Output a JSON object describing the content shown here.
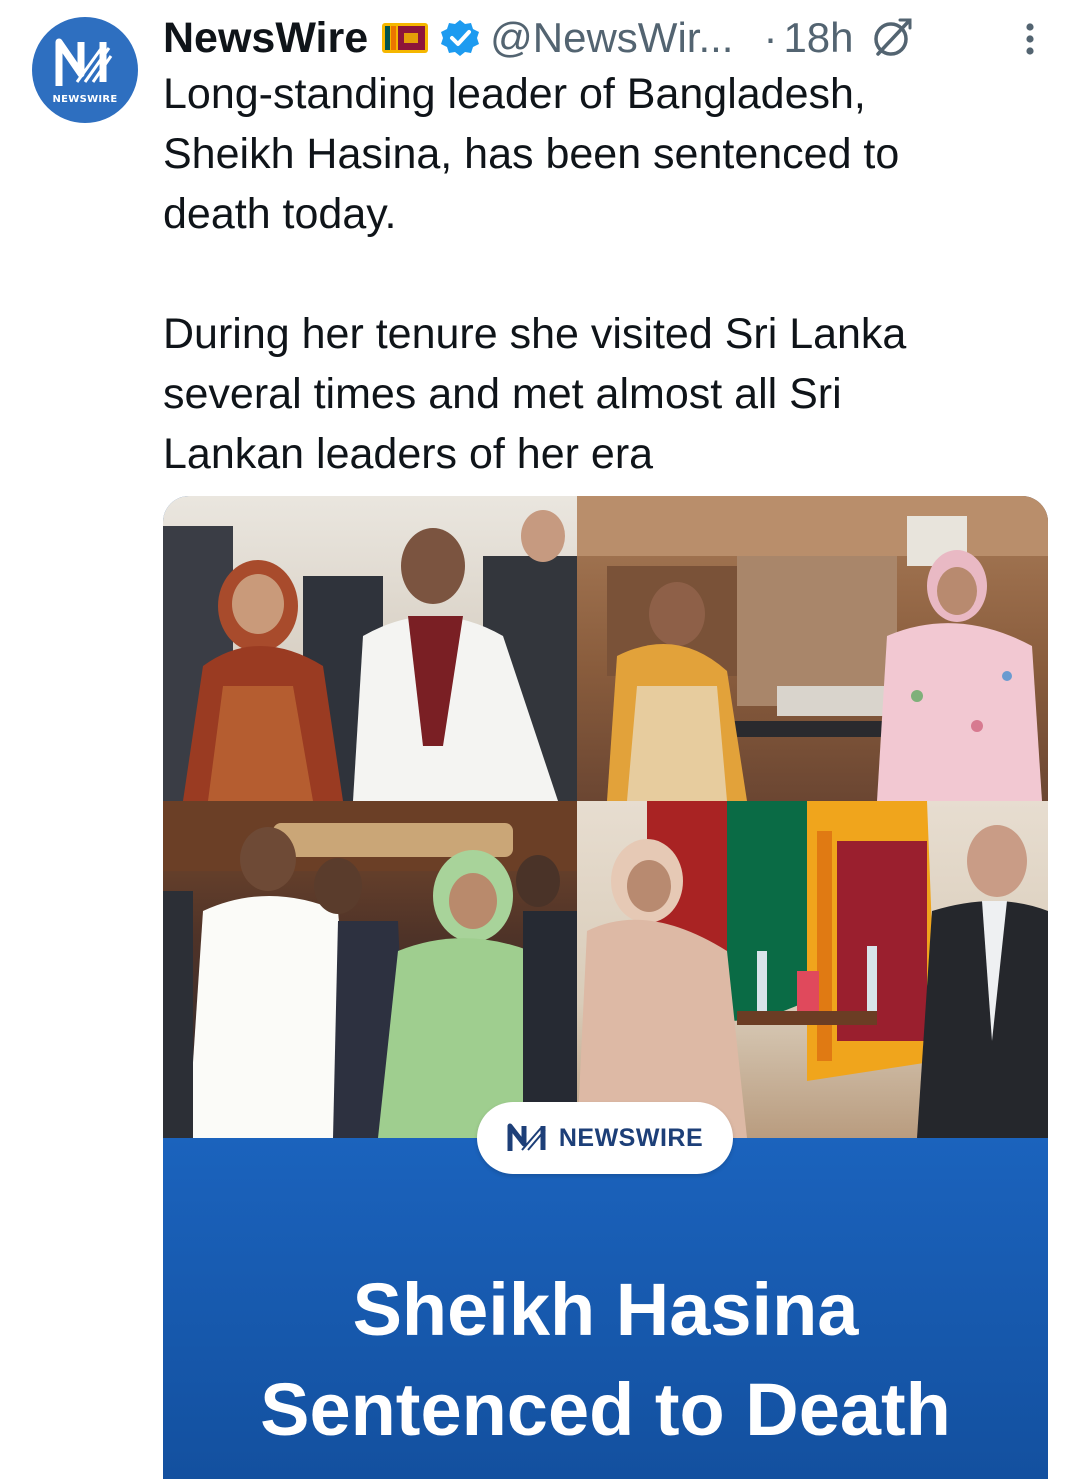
{
  "account": {
    "display_name": "NewsWire",
    "handle": "@NewsWir...",
    "separator": "·",
    "time": "18h",
    "avatar_label": "NEWSWIRE",
    "flag_icon": "sri-lanka-flag-emoji",
    "verified_icon": "verified-badge-icon",
    "verified_color": "#1d9bf0"
  },
  "tweet": {
    "paragraph_1": "Long-standing leader of Bangladesh,\nSheikh Hasina, has been sentenced to\ndeath today.",
    "paragraph_2": "During her tenure she visited Sri Lanka\nseveral times and met almost all Sri\nLankan leaders of her era"
  },
  "media": {
    "badge_text": "NEWSWIRE",
    "headline_line_1": "Sheikh Hasina",
    "headline_line_2": "Sentenced to Death",
    "brand_color": "#1b63bd"
  },
  "icons": {
    "grok": "grok-icon",
    "more": "more-options-icon"
  }
}
